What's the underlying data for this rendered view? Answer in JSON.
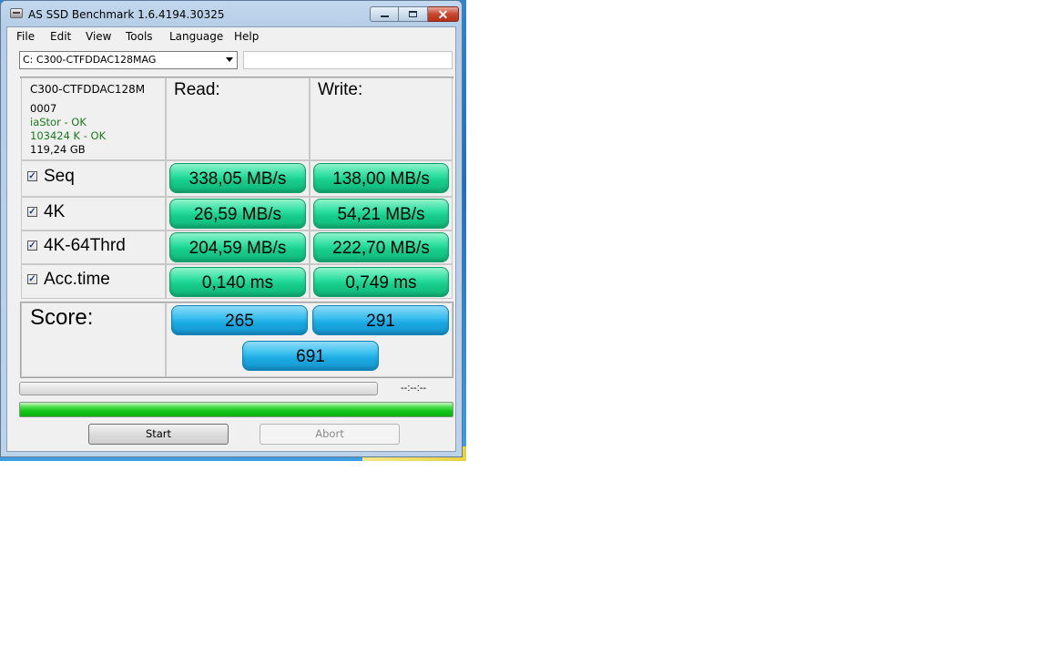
{
  "window": {
    "title": "AS SSD Benchmark 1.6.4194.30325",
    "close_glyph": "✕"
  },
  "menu": [
    {
      "label": "File"
    },
    {
      "label": "Edit"
    },
    {
      "label": "View"
    },
    {
      "label": "Tools"
    },
    {
      "label": "Language"
    },
    {
      "label": "Help"
    }
  ],
  "drive": {
    "selected": "C: C300-CTFDDAC128MAG",
    "extra_field": ""
  },
  "drive_info": {
    "model": "C300-CTFDDAC128M",
    "firmware": "0007",
    "driver_status": "iaStor - OK",
    "alignment_status": "103424 K - OK",
    "capacity": "119,24 GB"
  },
  "columns": {
    "read": "Read:",
    "write": "Write:"
  },
  "tests": [
    {
      "label": "Seq",
      "checked": true,
      "check_glyph": "✓",
      "read": "338,05 MB/s",
      "write": "138,00 MB/s"
    },
    {
      "label": "4K",
      "checked": true,
      "check_glyph": "✓",
      "read": "26,59 MB/s",
      "write": "54,21 MB/s"
    },
    {
      "label": "4K-64Thrd",
      "checked": true,
      "check_glyph": "✓",
      "read": "204,59 MB/s",
      "write": "222,70 MB/s"
    },
    {
      "label": "Acc.time",
      "checked": true,
      "check_glyph": "✓",
      "read": "0,140 ms",
      "write": "0,749 ms"
    }
  ],
  "score": {
    "label": "Score:",
    "read": "265",
    "write": "291",
    "total": "691"
  },
  "progress": {
    "time": "--:--:--",
    "main_fraction": 0.0,
    "total_fraction": 1.0
  },
  "buttons": {
    "start": "Start",
    "abort": "Abort"
  },
  "colors": {
    "value_green": "#2fe0a2",
    "score_blue": "#3cc0ef",
    "ok_text": "#1a7a1a"
  }
}
